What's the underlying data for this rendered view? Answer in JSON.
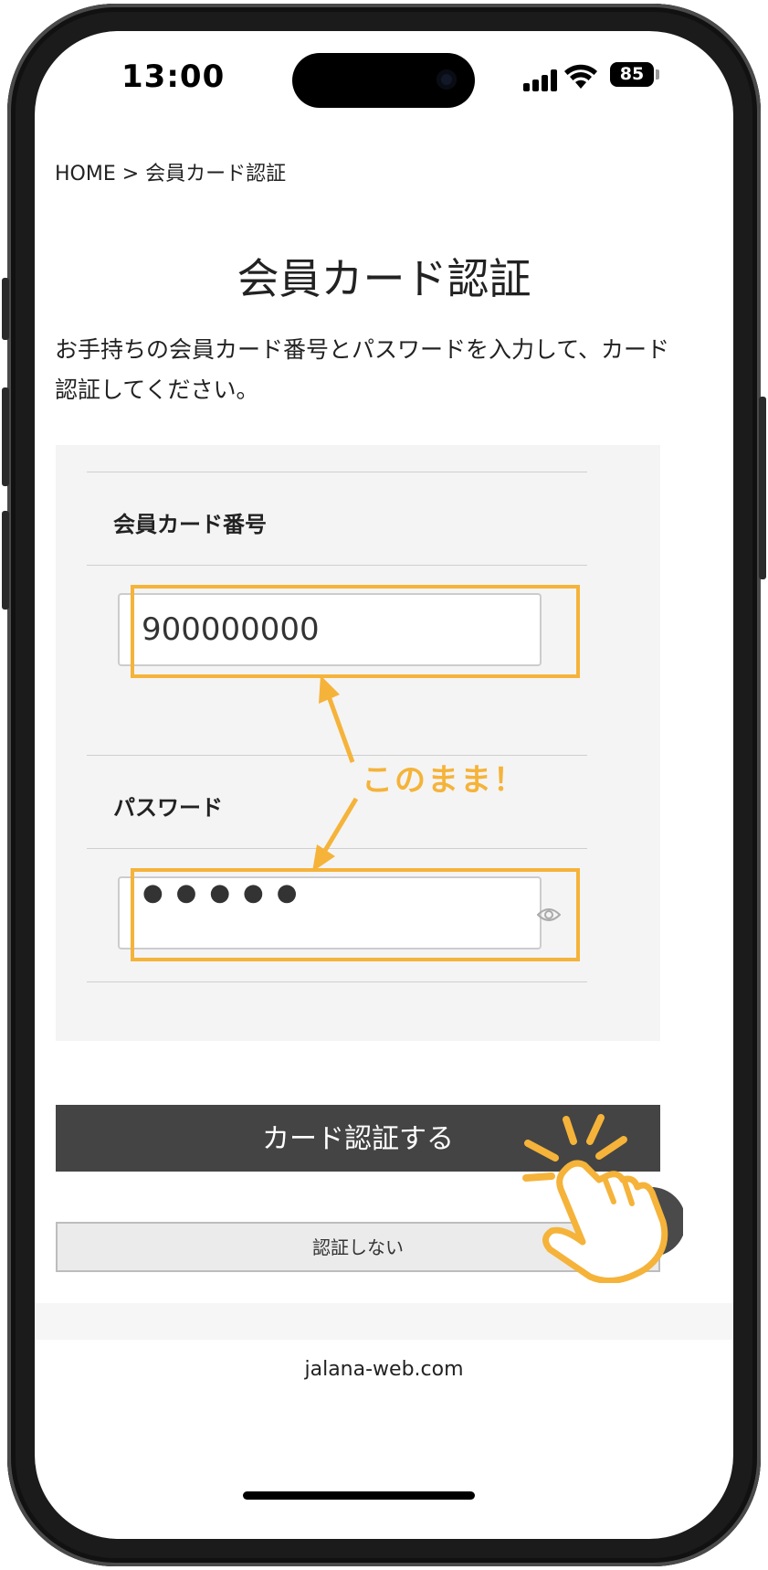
{
  "status_bar": {
    "time": "13:00",
    "battery": "85",
    "icons": [
      "signal-icon",
      "wifi-icon",
      "battery-icon"
    ]
  },
  "breadcrumb": "HOME > 会員カード認証",
  "page_title": "会員カード認証",
  "instructions": "お手持ちの会員カード番号とパスワードを入力して、カード認証してください。",
  "form": {
    "card_number_label": "会員カード番号",
    "card_number_value": "900000000",
    "password_label": "パスワード",
    "password_mask": "●●●●●"
  },
  "annotation": "このまま！",
  "buttons": {
    "authenticate": "カード認証する",
    "skip": "認証しない"
  },
  "footer": {
    "url": "jalana-web.com"
  },
  "colors": {
    "accent": "#f5b33a",
    "primary_button": "#444444"
  }
}
